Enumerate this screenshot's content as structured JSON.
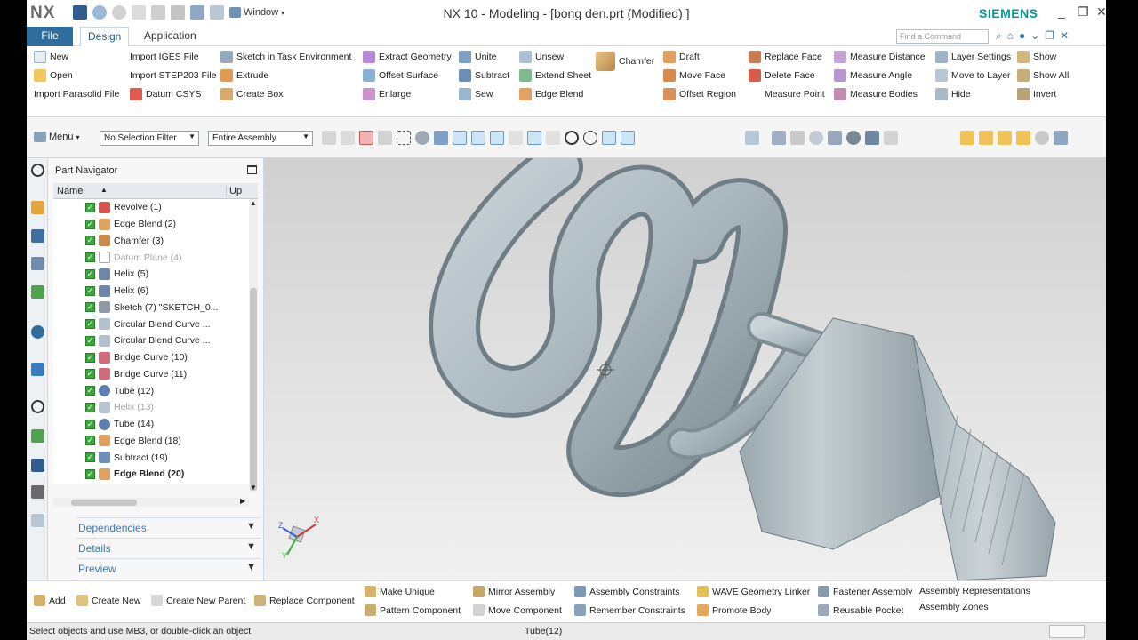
{
  "window": {
    "app_logo": "NX",
    "window_menu": "Window",
    "title": "NX 10 - Modeling - [bong den.prt (Modified) ]",
    "brand": "SIEMENS"
  },
  "tabs": {
    "file": "File",
    "design": "Design",
    "application": "Application"
  },
  "command_search": {
    "placeholder": "Find a Command"
  },
  "ribbon": {
    "col1": [
      "New",
      "Open",
      "Import Parasolid File"
    ],
    "col2": [
      "Import IGES File",
      "Import STEP203 File",
      "Datum CSYS"
    ],
    "col3": [
      "Sketch in Task Environment",
      "Extrude",
      "Create Box"
    ],
    "col4": [
      "Extract Geometry",
      "Offset Surface",
      "Enlarge"
    ],
    "col5": [
      "Unite",
      "Subtract",
      "Sew"
    ],
    "col6": [
      "Unsew",
      "Extend Sheet",
      "Edge Blend"
    ],
    "chamfer": "Chamfer",
    "col7": [
      "Draft",
      "Move Face",
      "Offset Region"
    ],
    "col8": [
      "Replace Face",
      "Delete Face",
      "Measure Point"
    ],
    "col9": [
      "Measure Distance",
      "Measure Angle",
      "Measure Bodies"
    ],
    "col10": [
      "Layer Settings",
      "Move to Layer",
      "Hide"
    ],
    "col11": [
      "Show",
      "Show All",
      "Invert"
    ]
  },
  "toolbar": {
    "menu": "Menu",
    "selection_filter": "No Selection Filter",
    "scope": "Entire Assembly"
  },
  "part_navigator": {
    "title": "Part Navigator",
    "col_name": "Name",
    "col_up": "Up",
    "rows": [
      {
        "label": "Revolve (1)"
      },
      {
        "label": "Edge Blend (2)"
      },
      {
        "label": "Chamfer (3)"
      },
      {
        "label": "Datum Plane (4)"
      },
      {
        "label": "Helix (5)"
      },
      {
        "label": "Helix (6)"
      },
      {
        "label": "Sketch (7) \"SKETCH_0..."
      },
      {
        "label": "Circular Blend Curve ..."
      },
      {
        "label": "Circular Blend Curve ..."
      },
      {
        "label": "Bridge Curve (10)"
      },
      {
        "label": "Bridge Curve (11)"
      },
      {
        "label": "Tube (12)"
      },
      {
        "label": "Helix (13)"
      },
      {
        "label": "Tube (14)"
      },
      {
        "label": "Edge Blend (18)"
      },
      {
        "label": "Subtract (19)"
      },
      {
        "label": "Edge Blend (20)"
      }
    ],
    "panels": [
      "Dependencies",
      "Details",
      "Preview"
    ]
  },
  "triad": {
    "x": "X",
    "y": "Y",
    "z": "Z"
  },
  "bottom_ribbon": {
    "items_row1": [
      "Add",
      "Create New",
      "Create New Parent",
      "Replace Component"
    ],
    "col2": [
      "Make Unique",
      "Pattern Component"
    ],
    "col3": [
      "Mirror Assembly",
      "Move Component"
    ],
    "col4": [
      "Assembly Constraints",
      "Remember Constraints"
    ],
    "col5": [
      "WAVE Geometry Linker",
      "Promote Body"
    ],
    "col6": [
      "Fastener Assembly",
      "Reusable Pocket"
    ],
    "col7": [
      "Assembly Representations",
      "Assembly Zones"
    ]
  },
  "status": {
    "message": "Select objects and use MB3, or double-click an object",
    "selection": "Tube(12)"
  },
  "colors": {
    "accent": "#2f6e9c",
    "brand": "#009999",
    "check": "#3aa83a"
  }
}
